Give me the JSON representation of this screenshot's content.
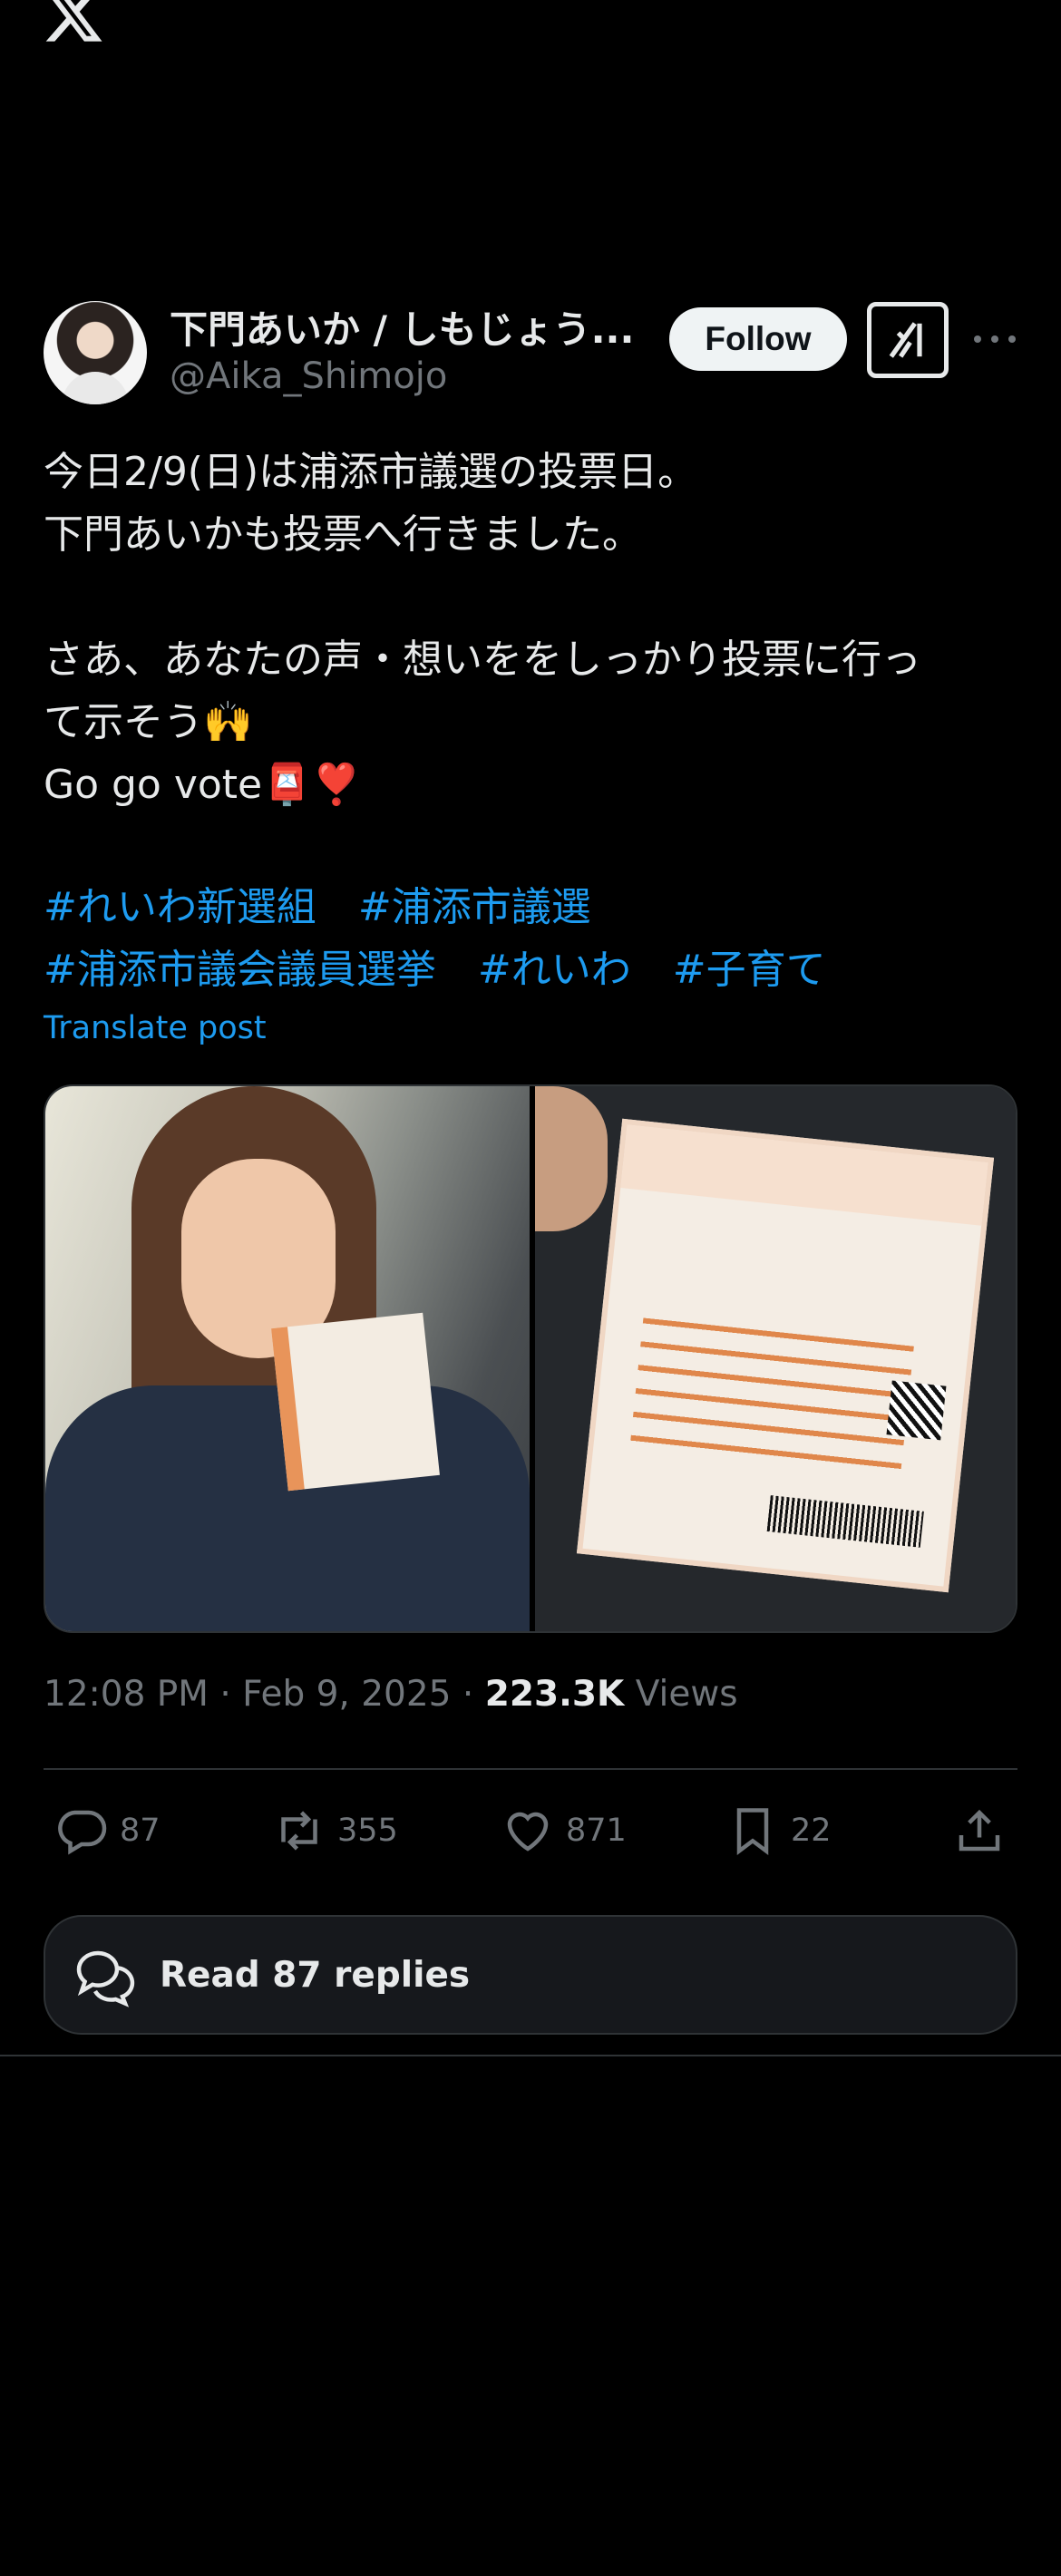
{
  "tweet": {
    "author_name": "下門あいか / しもじょう...",
    "author_handle": "@Aika_Shimojo",
    "follow_label": "Follow",
    "text_lines": [
      "今日2/9(日)は浦添市議選の投票日。",
      "下門あいかも投票へ行きました。",
      "",
      "さあ、あなたの声・想いををしっかり投票に行っ",
      "て示そう🙌",
      "Go go vote📮❣️"
    ],
    "hashtags_row1": [
      "#れいわ新選組",
      "#浦添市議選"
    ],
    "hashtags_row2": [
      "#浦添市議会議員選挙",
      "#れいわ",
      "#子育て"
    ],
    "translate_label": "Translate post",
    "time": "12:08 PM",
    "date": "Feb 9, 2025",
    "views_count": "223.3K",
    "views_label": "Views",
    "separator": " · "
  },
  "actions": {
    "replies": "87",
    "reposts": "355",
    "likes": "871",
    "bookmarks": "22"
  },
  "read_replies_label": "Read 87 replies",
  "icons": [
    "x-logo-icon",
    "grok-icon",
    "more-icon",
    "reply-icon",
    "repost-icon",
    "like-icon",
    "bookmark-icon",
    "share-icon",
    "chat-bubbles-icon"
  ]
}
